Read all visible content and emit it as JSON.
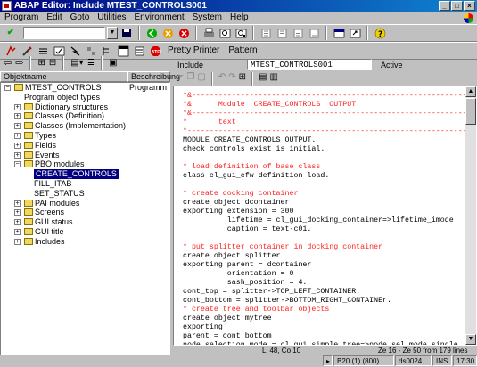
{
  "window": {
    "title": "ABAP Editor: Include MTEST_CONTROLS001",
    "buttons": [
      "_",
      "□",
      "×"
    ]
  },
  "menu": [
    "Program",
    "Edit",
    "Goto",
    "Utilities",
    "Environment",
    "System",
    "Help"
  ],
  "toolbar1": {
    "icons": [
      "check-icon",
      "command-field",
      "save-icon",
      "back-icon",
      "exit-icon",
      "cancel-icon",
      "print-icon",
      "find-icon",
      "find-next-icon",
      "first-page-icon",
      "prev-page-icon",
      "next-page-icon",
      "last-page-icon",
      "new-session-icon",
      "shortcut-icon",
      "help-icon"
    ]
  },
  "toolbar2": {
    "pretty_printer": "Pretty Printer",
    "pattern": "Pattern"
  },
  "tree": {
    "col_object": "Objektname",
    "col_desc": "Beschreibung",
    "items": [
      {
        "label": "MTEST_CONTROLS",
        "desc": "Programm MTE",
        "level": 0,
        "exp": "-",
        "folder": true
      },
      {
        "label": "Program object types",
        "desc": "",
        "level": 1,
        "exp": "",
        "folder": false
      },
      {
        "label": "Dictionary structures",
        "desc": "",
        "level": 1,
        "exp": "+",
        "folder": true
      },
      {
        "label": "Classes (Definition)",
        "desc": "",
        "level": 1,
        "exp": "+",
        "folder": true
      },
      {
        "label": "Classes (Implementation)",
        "desc": "",
        "level": 1,
        "exp": "+",
        "folder": true
      },
      {
        "label": "Types",
        "desc": "",
        "level": 1,
        "exp": "+",
        "folder": true
      },
      {
        "label": "Fields",
        "desc": "",
        "level": 1,
        "exp": "+",
        "folder": true
      },
      {
        "label": "Events",
        "desc": "",
        "level": 1,
        "exp": "+",
        "folder": true
      },
      {
        "label": "PBO modules",
        "desc": "",
        "level": 1,
        "exp": "-",
        "folder": true
      },
      {
        "label": "CREATE_CONTROLS",
        "desc": "",
        "level": 2,
        "exp": "",
        "folder": false,
        "selected": true
      },
      {
        "label": "FILL_ITAB",
        "desc": "",
        "level": 2,
        "exp": "",
        "folder": false
      },
      {
        "label": "SET_STATUS",
        "desc": "",
        "level": 2,
        "exp": "",
        "folder": false
      },
      {
        "label": "PAI modules",
        "desc": "",
        "level": 1,
        "exp": "+",
        "folder": true
      },
      {
        "label": "Screens",
        "desc": "",
        "level": 1,
        "exp": "+",
        "folder": true
      },
      {
        "label": "GUI status",
        "desc": "",
        "level": 1,
        "exp": "+",
        "folder": true
      },
      {
        "label": "GUI title",
        "desc": "",
        "level": 1,
        "exp": "+",
        "folder": true
      },
      {
        "label": "Includes",
        "desc": "",
        "level": 1,
        "exp": "+",
        "folder": true
      }
    ]
  },
  "editor": {
    "include_label": "Include",
    "include_value": "MTEST_CONTROLS001",
    "status": "Active",
    "code": [
      {
        "t": "c",
        "s": "*&---------------------------------------------------------------"
      },
      {
        "t": "c",
        "s": "*&      Module  CREATE_CONTROLS  OUTPUT"
      },
      {
        "t": "c",
        "s": "*&---------------------------------------------------------------"
      },
      {
        "t": "c",
        "s": "*       text"
      },
      {
        "t": "c",
        "s": "*---------------------------------------------------------------"
      },
      {
        "t": "k",
        "s": "MODULE CREATE_CONTROLS OUTPUT."
      },
      {
        "t": "k",
        "s": "check controls_exist is initial."
      },
      {
        "t": "k",
        "s": ""
      },
      {
        "t": "c",
        "s": "* load definition of base class"
      },
      {
        "t": "k",
        "s": "class cl_gui_cfw definition load."
      },
      {
        "t": "k",
        "s": ""
      },
      {
        "t": "c",
        "s": "* create docking container"
      },
      {
        "t": "k",
        "s": "create object dcontainer"
      },
      {
        "t": "k",
        "s": "exporting extension = 300"
      },
      {
        "t": "k",
        "s": "          lifetime = cl_gui_docking_container=>lifetime_imode"
      },
      {
        "t": "k",
        "s": "          caption = text-c01."
      },
      {
        "t": "k",
        "s": ""
      },
      {
        "t": "c",
        "s": "* put splitter container in docking container"
      },
      {
        "t": "k",
        "s": "create object splitter"
      },
      {
        "t": "k",
        "s": "exporting parent = dcontainer"
      },
      {
        "t": "k",
        "s": "          orientation = 0"
      },
      {
        "t": "k",
        "s": "          sash_position = 4."
      },
      {
        "t": "k",
        "s": "cont_top = splitter->TOP_LEFT_CONTAINER."
      },
      {
        "t": "k",
        "s": "cont_bottom = splitter->BOTTOM_RIGHT_CONTAINEr."
      },
      {
        "t": "c",
        "s": "* create tree and toolbar objects"
      },
      {
        "t": "k",
        "s": "create object mytree"
      },
      {
        "t": "k",
        "s": "exporting"
      },
      {
        "t": "k",
        "s": "parent = cont_bottom"
      },
      {
        "t": "k",
        "s": "node_selection_mode = cl_gui_simple_tree=>node_sel_mode_single."
      }
    ],
    "line_info": "Li 48, Co 10",
    "range_info": "Ze 16 - Ze 50 from 179 lines"
  },
  "status": {
    "system": "B20 (1) (800)",
    "server": "ds0024",
    "mode": "INS",
    "time": "17:30"
  },
  "colors": {
    "title_start": "#000080",
    "title_end": "#1084d0",
    "comment": "#ff2020",
    "selection": "#000080"
  }
}
